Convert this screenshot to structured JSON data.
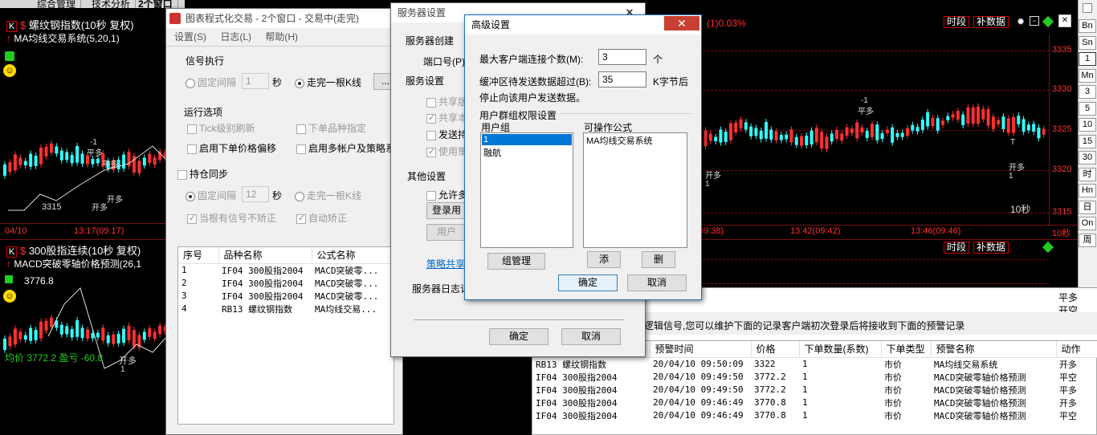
{
  "top_tabs": [
    "综合管理",
    "技术分析",
    "2个窗口"
  ],
  "left_chart1": {
    "tag": "K",
    "title": "螺纹钢指数(10秒 复权)",
    "indicator": "MA均线交易系统(5,20,1)",
    "price_label": "3315",
    "bottom_left": "04/10",
    "bottom_mid": "13:17(09:17)",
    "sig_labels": [
      "-1",
      "平多",
      "-1",
      "平多",
      "开多",
      "开多",
      "1",
      "1"
    ]
  },
  "left_chart2": {
    "tag": "K",
    "title": "300股指连续(10秒 复权)",
    "indicator": "MACD突破零轴价格预测(26,1",
    "price": "3776.8",
    "avg_label": "均价",
    "avg_value": "3772.2",
    "profit_label": "盈亏",
    "profit_value": "-60.8",
    "sig": "开多",
    "sig_num": "1"
  },
  "right_chart1": {
    "pct_text": "(1)0.03%",
    "btn_period": "时段",
    "btn_more": "补数据",
    "prices": [
      "3335",
      "3330",
      "3325",
      "3320",
      "3315"
    ],
    "times": [
      "09:38)",
      "13:42(09:42)",
      "13:46(09:46)",
      "10秒"
    ],
    "label_10s": "10秒",
    "sig_a": "-1",
    "sig_b": "平多",
    "sig_c": "开多",
    "sig_d": "1",
    "sig_e": "开多",
    "sig_f": "1",
    "sig_g": "T"
  },
  "right_chart2": {
    "btn_period": "时段",
    "btn_more": "补数据"
  },
  "right_toolbar": [
    "Bn",
    "Sn",
    "1",
    "Mn",
    "3",
    "5",
    "10",
    "15",
    "30",
    "时",
    "Hn",
    "日",
    "On",
    "周"
  ],
  "main_window": {
    "title": "图表程式化交易 - 2个窗口 - 交易中(走完)",
    "menu": [
      "设置(S)",
      "日志(L)",
      "帮助(H)"
    ],
    "sig_exec": "信号执行",
    "fixed_interval": "固定间隔",
    "fixed_val": "1",
    "sec": "秒",
    "finish_bar": "走完一根K线",
    "run_opts": "运行选项",
    "tick_refresh": "Tick级别刷新",
    "order_type": "下单品种指定",
    "enable_offset": "启用下单价格偏移",
    "enable_multi": "启用多帐户及策略系",
    "pos_sync": "持仓同步",
    "fixed_interval2": "固定间隔",
    "fixed_val2": "12",
    "sec2": "秒",
    "finish_bar2": "走完一根K线",
    "no_correct": "当根有信号不矫正",
    "auto_correct": "自动矫正",
    "table_headers": [
      "序号",
      "品种名称",
      "公式名称"
    ],
    "rows": [
      [
        "1",
        "IF04 300股指2004",
        "MACD突破零..."
      ],
      [
        "2",
        "IF04 300股指2004",
        "MACD突破零..."
      ],
      [
        "3",
        "IF04 300股指2004",
        "MACD突破零..."
      ],
      [
        "4",
        "RB13 螺纹钢指数",
        "MA均线交易..."
      ]
    ]
  },
  "server_window": {
    "title": "服务器设置",
    "create": "服务器创建",
    "port": "端口号(P)",
    "srv_settings": "服务设置",
    "share1": "共享版",
    "share2": "共享本",
    "send": "发送持",
    "use_strat": "使用策",
    "other": "其他设置",
    "allow": "允许多",
    "login": "登录用",
    "user": "用户",
    "strat_link": "策略共享",
    "log": "服务器日志记",
    "ok": "确定",
    "cancel": "取消"
  },
  "adv_dialog": {
    "title": "高级设置",
    "close": "✕",
    "max_clients_label": "最大客户端连接个数(M):",
    "max_clients": "3",
    "max_unit": "个",
    "buffer_label": "缓冲区待发送数据超过(B):",
    "buffer_val": "35",
    "buffer_unit": "K字节后",
    "buffer_tail": "停止向该用户发送数据。",
    "group_title": "用户群组权限设置",
    "user_group": "用户组",
    "formulas": "可操作公式",
    "groups": [
      "1",
      "融航"
    ],
    "formula_items": [
      "MA均线交易系统"
    ],
    "grp_mgr": "组管理",
    "add": "添",
    "del": "删",
    "ok": "确定",
    "cancel": "取消"
  },
  "alert_panel": {
    "desc": "逻辑信号,您可以维护下面的记录客户端初次登录后将接收到下面的预警记录",
    "headers": [
      "",
      "预警时间",
      "价格",
      "下单数量(系数)",
      "下单类型",
      "预警名称",
      "动作"
    ],
    "rows": [
      [
        "RB13 螺纹钢指数",
        "20/04/10 09:50:09",
        "3322",
        "1",
        "市价",
        "MA均线交易系统",
        "开多"
      ],
      [
        "IF04 300股指2004",
        "20/04/10 09:49:50",
        "3772.2",
        "1",
        "市价",
        "MACD突破零轴价格预测",
        "平空"
      ],
      [
        "IF04 300股指2004",
        "20/04/10 09:49:50",
        "3772.2",
        "1",
        "市价",
        "MACD突破零轴价格预测",
        "平多"
      ],
      [
        "IF04 300股指2004",
        "20/04/10 09:46:49",
        "3770.8",
        "1",
        "市价",
        "MACD突破零轴价格预测",
        "开多"
      ],
      [
        "IF04 300股指2004",
        "20/04/10 09:46:49",
        "3770.8",
        "1",
        "市价",
        "MACD突破零轴价格预测",
        "平空"
      ]
    ],
    "right_actions": [
      "平多",
      "开空"
    ]
  },
  "colors": {
    "up": "#ff3030",
    "down": "#33ffff",
    "bg": "#000000",
    "win": "#f0f0f0"
  }
}
